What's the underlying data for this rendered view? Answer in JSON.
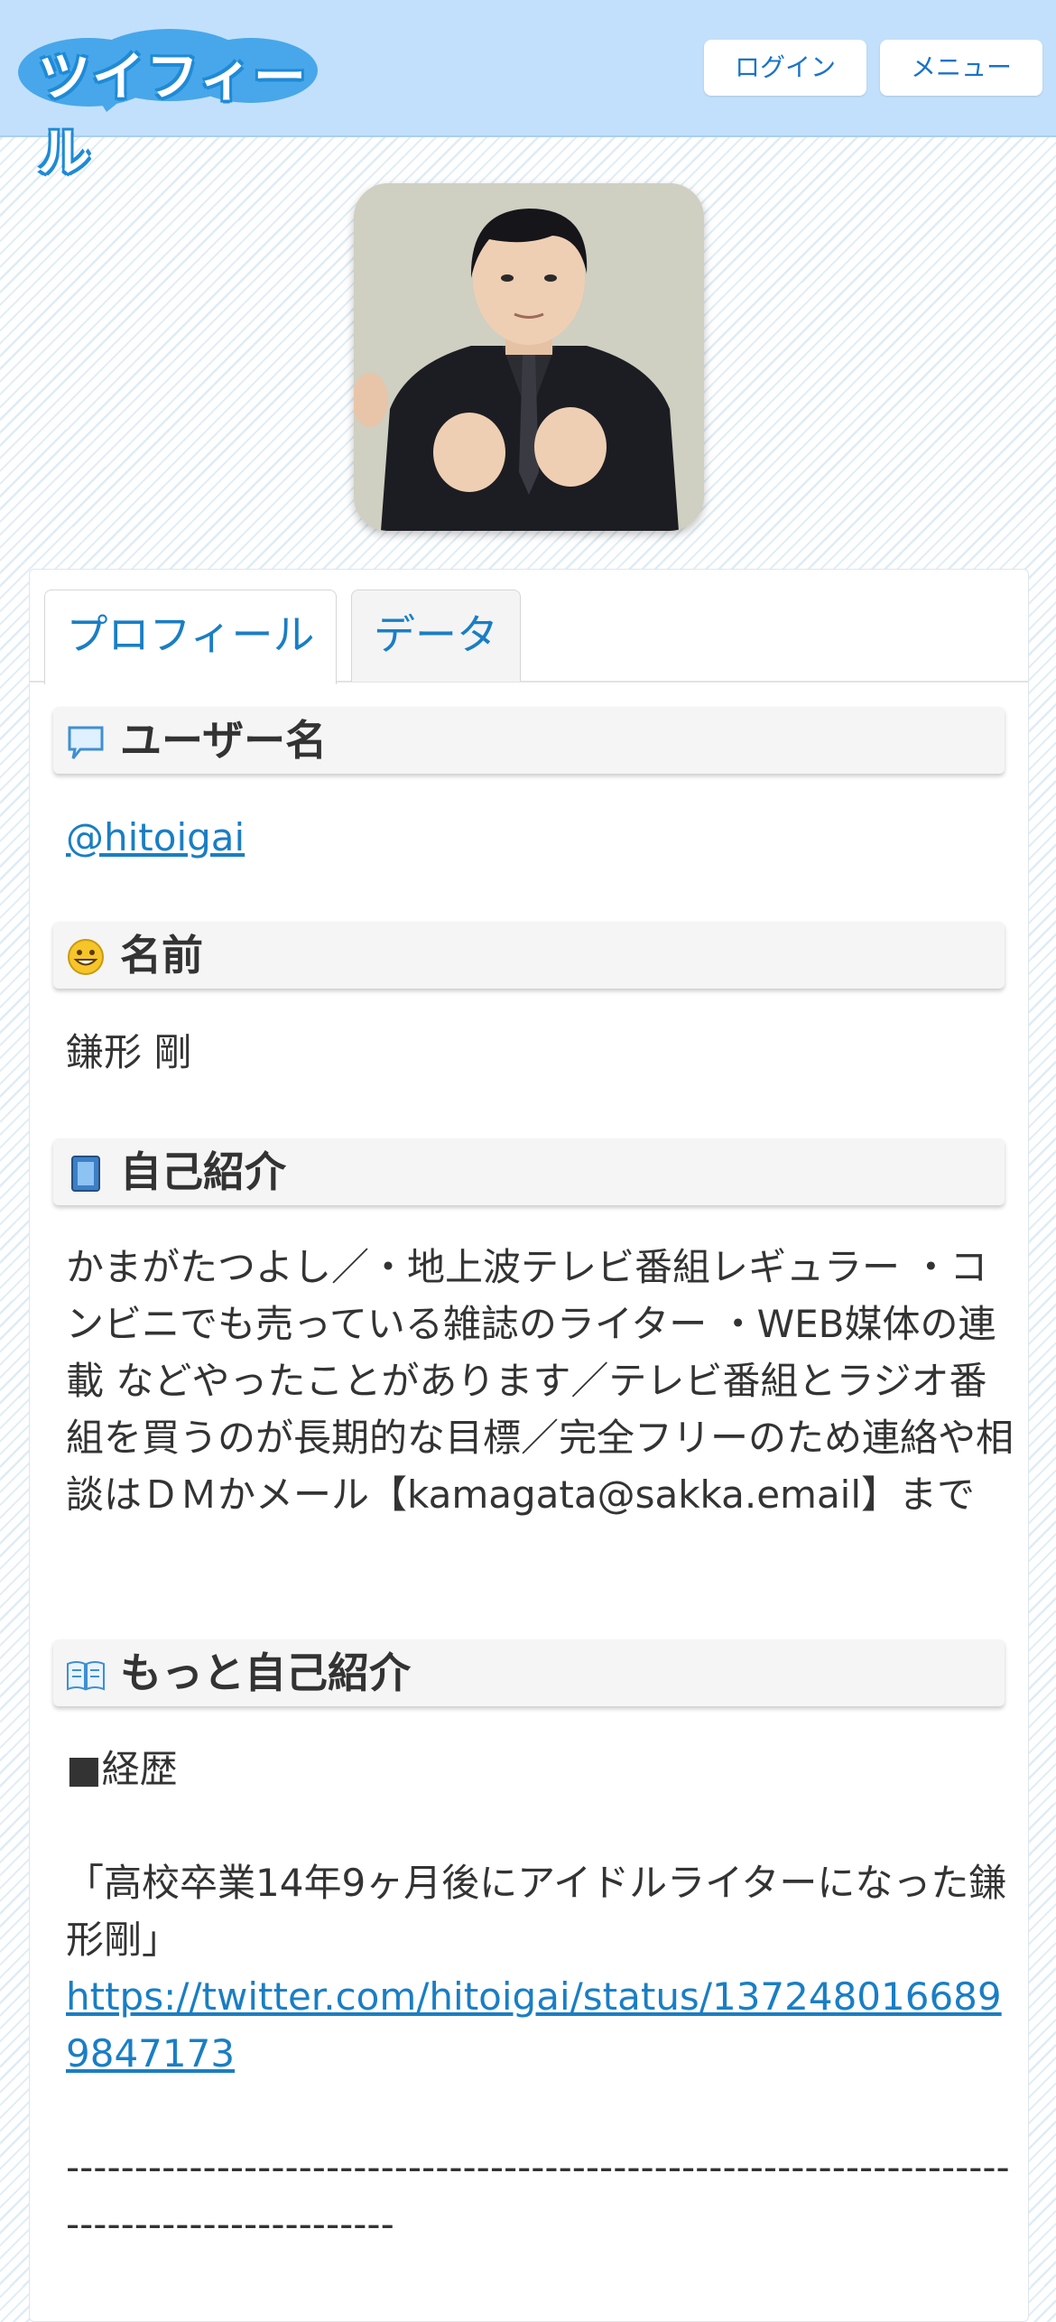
{
  "header": {
    "logo_text": "ツイフィール",
    "login_label": "ログイン",
    "menu_label": "メニュー"
  },
  "tabs": [
    {
      "label": "プロフィール",
      "active": true
    },
    {
      "label": "データ",
      "active": false
    }
  ],
  "sections": {
    "username": {
      "title": "ユーザー名",
      "value": "@hitoigai",
      "icon": "speech-bubble-icon"
    },
    "name": {
      "title": "名前",
      "value": "鎌形 剛",
      "icon": "smiley-face-icon"
    },
    "bio": {
      "title": "自己紹介",
      "icon": "notebook-icon",
      "text": "かまがたつよし／・地上波テレビ番組レギュラー ・コンビニでも売っている雑誌のライター ・WEB媒体の連載 などやったことがあります／テレビ番組とラジオ番組を買うのが長期的な目標／完全フリーのため連絡や相談はＤＭかメール【kamagata@sakka.email】まで"
    },
    "more_bio": {
      "title": "もっと自己紹介",
      "icon": "open-book-icon",
      "heading": "■経歴",
      "quote": "「高校卒業14年9ヶ月後にアイドルライターになった鎌形剛」",
      "link": "https://twitter.com/hitoigai/status/1372480166899847173",
      "divider": "---------------------------------------------------------------------------------------------"
    }
  },
  "colors": {
    "header_bg": "#c2e0fb",
    "link": "#1a7ec4",
    "section_bg": "#f5f5f5"
  }
}
